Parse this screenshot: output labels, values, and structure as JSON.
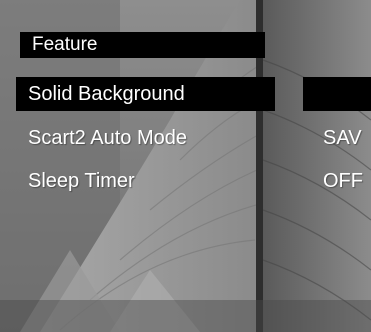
{
  "menu": {
    "title": "Feature",
    "items": [
      {
        "label": "Solid Background",
        "value": "",
        "selected": true
      },
      {
        "label": "Scart2 Auto Mode",
        "value": "SAV",
        "selected": false
      },
      {
        "label": "Sleep Timer",
        "value": "OFF",
        "selected": false
      }
    ]
  },
  "colors": {
    "highlight": "#000000",
    "text": "#ffffff",
    "background_tint": "#7a7a7a"
  }
}
